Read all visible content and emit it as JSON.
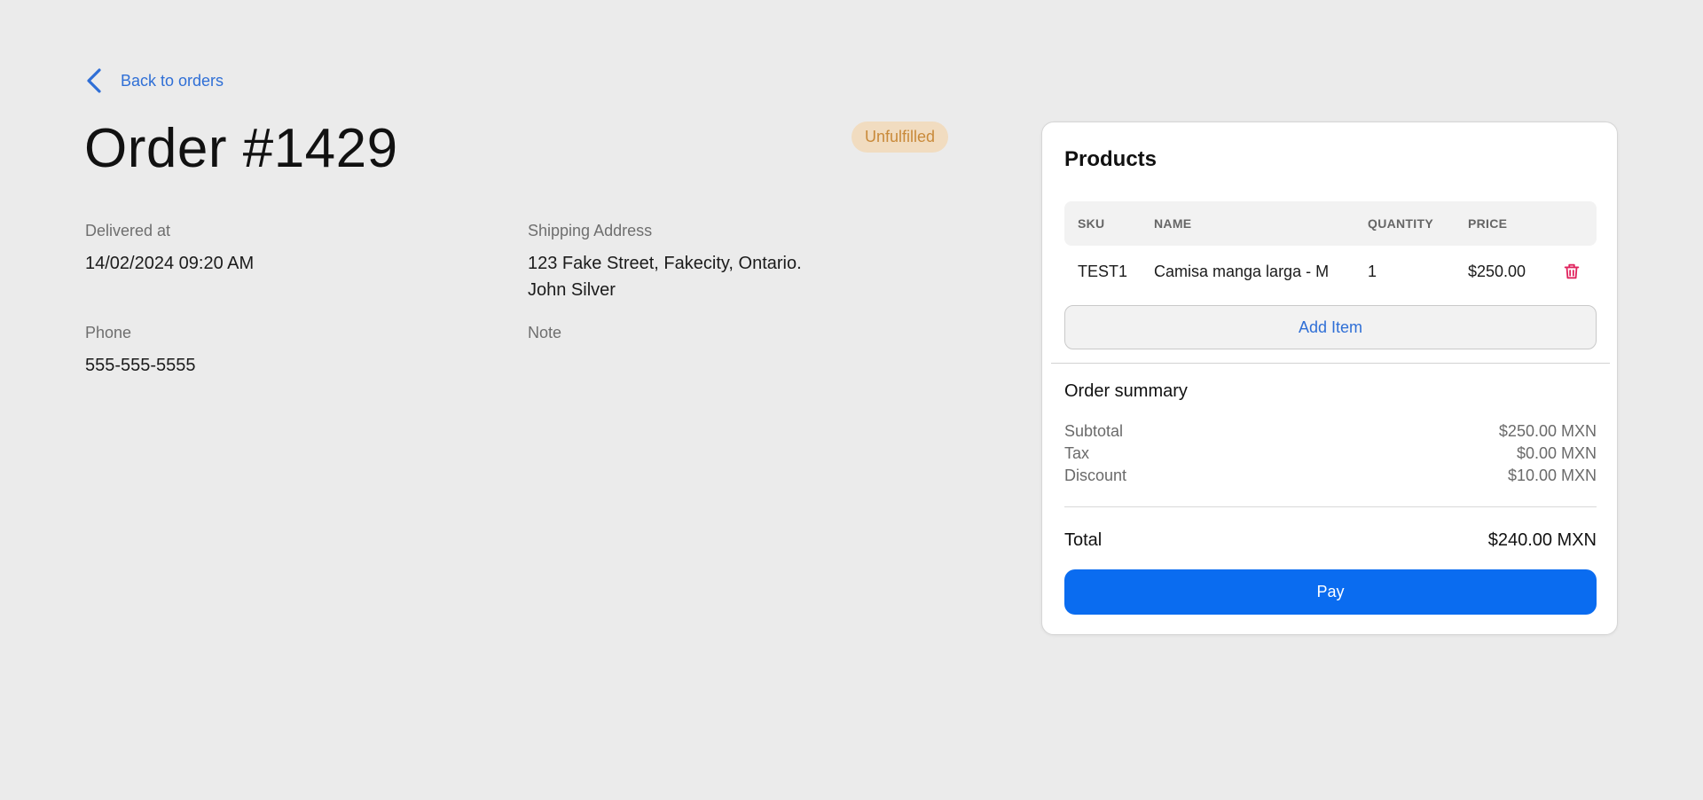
{
  "back_link": {
    "label": "Back to orders",
    "icon": "chevron-left-icon"
  },
  "order": {
    "title": "Order #1429",
    "status": "Unfulfilled"
  },
  "details": {
    "delivered_label": "Delivered at",
    "delivered_value": "14/02/2024 09:20 AM",
    "shipping_label": "Shipping Address",
    "shipping_line1": "123 Fake Street, Fakecity, Ontario.",
    "shipping_line2": "John Silver",
    "phone_label": "Phone",
    "phone_value": "555-555-5555",
    "note_label": "Note",
    "note_value": ""
  },
  "products": {
    "title": "Products",
    "columns": [
      "SKU",
      "NAME",
      "QUANTITY",
      "PRICE"
    ],
    "rows": [
      {
        "sku": "TEST1",
        "name": "Camisa manga larga - M",
        "quantity": "1",
        "price": "$250.00",
        "delete_icon": "trash-icon"
      }
    ],
    "add_item_label": "Add Item"
  },
  "summary": {
    "title": "Order summary",
    "subtotal_label": "Subtotal",
    "subtotal_value": "$250.00 MXN",
    "tax_label": "Tax",
    "tax_value": "$0.00 MXN",
    "discount_label": "Discount",
    "discount_value": "$10.00 MXN",
    "total_label": "Total",
    "total_value": "$240.00 MXN",
    "pay_label": "Pay"
  },
  "colors": {
    "accent": "#0a6cf0",
    "link": "#2f6fd6",
    "badge_bg": "#f1dcc0",
    "badge_text": "#c98a3a",
    "danger": "#e0245e"
  }
}
